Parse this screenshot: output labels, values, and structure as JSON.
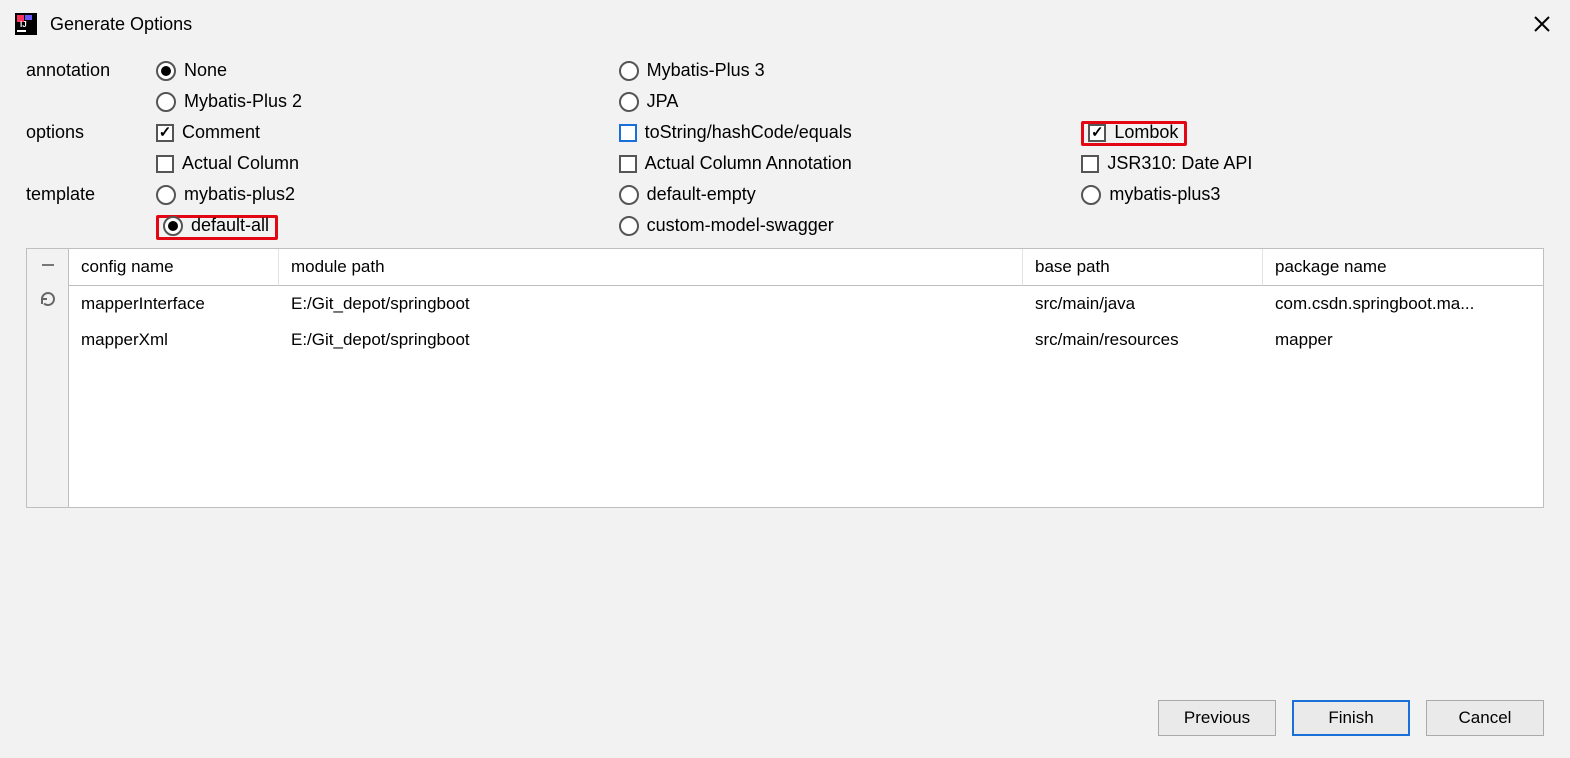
{
  "title": "Generate Options",
  "labels": {
    "annotation": "annotation",
    "options": "options",
    "template": "template"
  },
  "annotation": {
    "none": "None",
    "mybatisPlus2": "Mybatis-Plus 2",
    "mybatisPlus3": "Mybatis-Plus 3",
    "jpa": "JPA"
  },
  "options": {
    "comment": "Comment",
    "toString": "toString/hashCode/equals",
    "lombok": "Lombok",
    "actualColumn": "Actual Column",
    "actualColumnAnnotation": "Actual Column Annotation",
    "jsr310": "JSR310: Date API"
  },
  "template": {
    "mybatisPlus2": "mybatis-plus2",
    "defaultEmpty": "default-empty",
    "mybatisPlus3": "mybatis-plus3",
    "defaultAll": "default-all",
    "customModelSwagger": "custom-model-swagger"
  },
  "table": {
    "headers": {
      "configName": "config name",
      "modulePath": "module path",
      "basePath": "base path",
      "packageName": "package name"
    },
    "rows": [
      {
        "configName": "mapperInterface",
        "modulePath": "E:/Git_depot/springboot",
        "basePath": "src/main/java",
        "packageName": "com.csdn.springboot.ma..."
      },
      {
        "configName": "mapperXml",
        "modulePath": "E:/Git_depot/springboot",
        "basePath": "src/main/resources",
        "packageName": "mapper"
      }
    ]
  },
  "buttons": {
    "previous": "Previous",
    "finish": "Finish",
    "cancel": "Cancel"
  }
}
